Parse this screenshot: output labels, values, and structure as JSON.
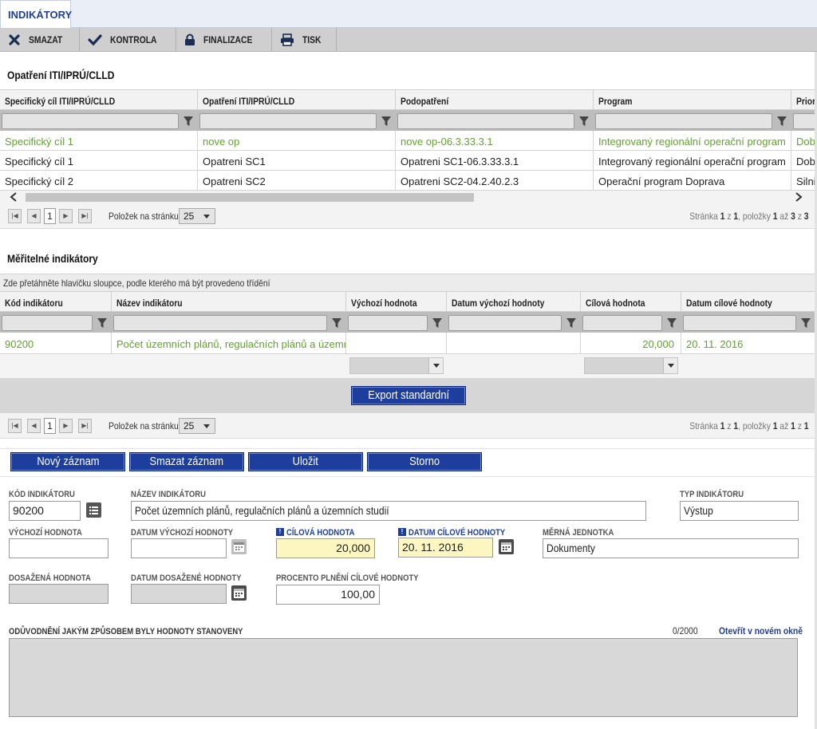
{
  "tab": {
    "label": "INDIKÁTORY"
  },
  "toolbar": {
    "smazat": "SMAZAT",
    "kontrola": "KONTROLA",
    "finalizace": "FINALIZACE",
    "tisk": "TISK"
  },
  "grid1": {
    "title": "Opatření ITI/IPRÚ/CLLD",
    "columns": [
      "Specifický cíl ITI/IPRÚ/CLLD",
      "Opatření ITI/IPRÚ/CLLD",
      "Podopatření",
      "Program",
      "Prior"
    ],
    "rows": [
      [
        "Specifický cíl 1",
        "nove op",
        "nove op-06.3.33.3.1",
        "Integrovaný regionální operační program",
        "Dobr"
      ],
      [
        "Specifický cíl 1",
        "Opatreni SC1",
        "Opatreni SC1-06.3.33.3.1",
        "Integrovaný regionální operační program",
        "Dobr"
      ],
      [
        "Specifický cíl 2",
        "Opatreni SC2",
        "Opatreni SC2-04.2.40.2.3",
        "Operační program Doprava",
        "Silni"
      ]
    ],
    "pager": {
      "page": "1",
      "per_page_label": "Položek na stránku",
      "per_page": "25",
      "info_a": "Stránka ",
      "p1": "1",
      "info_b": " z ",
      "p2": "1",
      "info_c": ", položky ",
      "p3": "1",
      "info_d": " až ",
      "p4": "3",
      "info_e": " z ",
      "p5": "3"
    }
  },
  "grid2": {
    "title": "Měřitelné indikátory",
    "group_hint": "Zde přetáhněte hlavičku sloupce, podle kterého má být provedeno třídění",
    "columns": [
      "Kód indikátoru",
      "Název indikátoru",
      "Výchozí hodnota",
      "Datum výchozí hodnoty",
      "Cílová hodnota",
      "Datum cílové hodnoty"
    ],
    "rows": [
      [
        "90200",
        "Počet územních plánů, regulačních plánů a územníc...",
        "",
        "",
        "20,000",
        "20. 11. 2016"
      ]
    ],
    "export_label": "Export standardní",
    "pager": {
      "page": "1",
      "per_page_label": "Položek na stránku",
      "per_page": "25",
      "info_a": "Stránka ",
      "p1": "1",
      "info_b": " z ",
      "p2": "1",
      "info_c": ", položky ",
      "p3": "1",
      "info_d": " až ",
      "p4": "1",
      "info_e": " z ",
      "p5": "1"
    }
  },
  "actions": {
    "new": "Nový záznam",
    "delete": "Smazat záznam",
    "save": "Uložit",
    "cancel": "Storno"
  },
  "form": {
    "kod_label": "KÓD INDIKÁTORU",
    "kod": "90200",
    "nazev_label": "NÁZEV INDIKÁTORU",
    "nazev": "Počet územních plánů, regulačních plánů a územních studií",
    "typ_label": "TYP INDIKÁTORU",
    "typ": "Výstup",
    "vychozi_label": "VÝCHOZÍ HODNOTA",
    "vychozi": "",
    "datum_vychozi_label": "DATUM VÝCHOZÍ HODNOTY",
    "datum_vychozi": "",
    "cilova_label": "CÍLOVÁ HODNOTA",
    "cilova": "20,000",
    "datum_cilove_label": "DATUM CÍLOVÉ HODNOTY",
    "datum_cilove": "20. 11. 2016",
    "jednotka_label": "MĚRNÁ JEDNOTKA",
    "jednotka": "Dokumenty",
    "dosazena_label": "DOSAŽENÁ HODNOTA",
    "dosazena": "",
    "datum_dosazene_label": "DATUM DOSAŽENÉ HODNOTY",
    "datum_dosazene": "",
    "procento_label": "PROCENTO PLNĚNÍ CÍLOVÉ HODNOTY",
    "procento": "100,00",
    "oduvodneni_label": "ODŮVODNĚNÍ JAKÝM ZPŮSOBEM BYLY HODNOTY STANOVENY",
    "counter": "0/2000",
    "open_new": "Otevřít v novém okně",
    "req_mark": "!"
  },
  "colors": {
    "accent": "#1e3e9e",
    "green": "#5fa52a",
    "required_bg": "#fcf7c1"
  }
}
